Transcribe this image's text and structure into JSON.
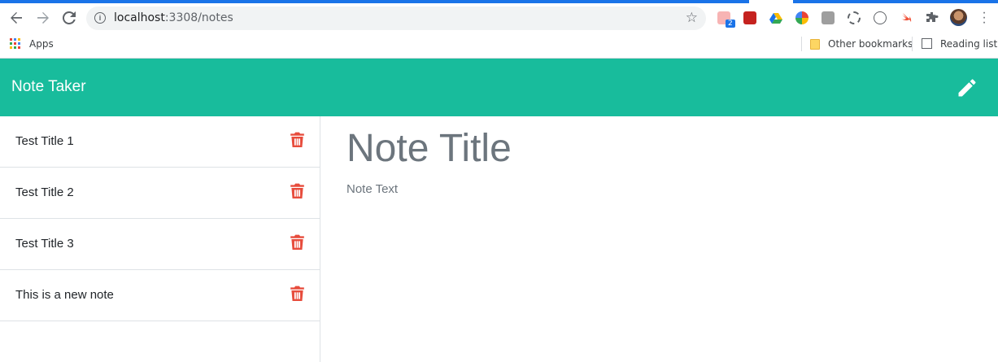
{
  "browser": {
    "url_host": "localhost",
    "url_path": ":3308/notes",
    "bookmarks": {
      "apps_label": "Apps",
      "other_label": "Other bookmarks",
      "reading_label": "Reading list"
    },
    "extension_badge": "2"
  },
  "app": {
    "brand": "Note Taker",
    "accent_color": "#18bc9c",
    "trash_color": "#e74c3c"
  },
  "notes": [
    {
      "title": "Test Title 1"
    },
    {
      "title": "Test Title 2"
    },
    {
      "title": "Test Title 3"
    },
    {
      "title": "This is a new note"
    }
  ],
  "editor": {
    "title_placeholder": "Note Title",
    "text_placeholder": "Note Text"
  }
}
